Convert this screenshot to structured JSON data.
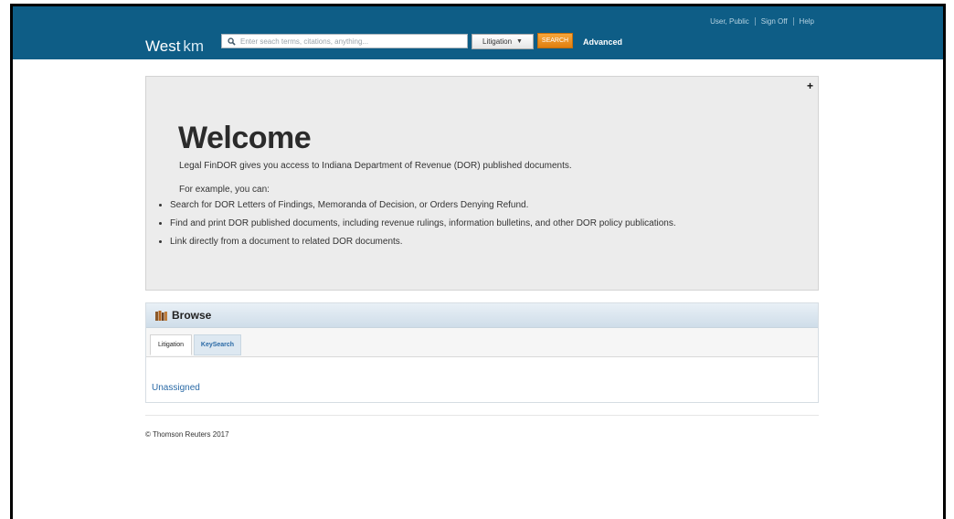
{
  "header": {
    "brand_main": "West",
    "brand_suffix": "km",
    "search_placeholder": "Enter seach terms, citations, anything...",
    "scope_value": "Litigation",
    "search_button": "SEARCH",
    "advanced_link": "Advanced",
    "links": [
      "User, Public",
      "Sign Off",
      "Help"
    ]
  },
  "welcome": {
    "title": "Welcome",
    "intro": "Legal FinDOR gives you access to Indiana Department of Revenue (DOR) published documents.",
    "example_heading": "For example, you can:",
    "bullets": [
      "Search for DOR Letters of Findings, Memoranda of Decision, or Orders Denying Refund.",
      "Find and print DOR published documents, including revenue rulings, information bulletins, and other DOR policy publications.",
      "Link directly from a document to related DOR documents."
    ],
    "expand_symbol": "+"
  },
  "browse": {
    "title": "Browse",
    "tabs": [
      "Litigation",
      "KeySearch"
    ],
    "items": [
      "Unassigned"
    ]
  },
  "footer": {
    "copyright": "© Thomson Reuters 2017"
  },
  "colors": {
    "topbar": "#0e5d86",
    "search_button": "#f39a2c",
    "link": "#2a6aa6"
  }
}
